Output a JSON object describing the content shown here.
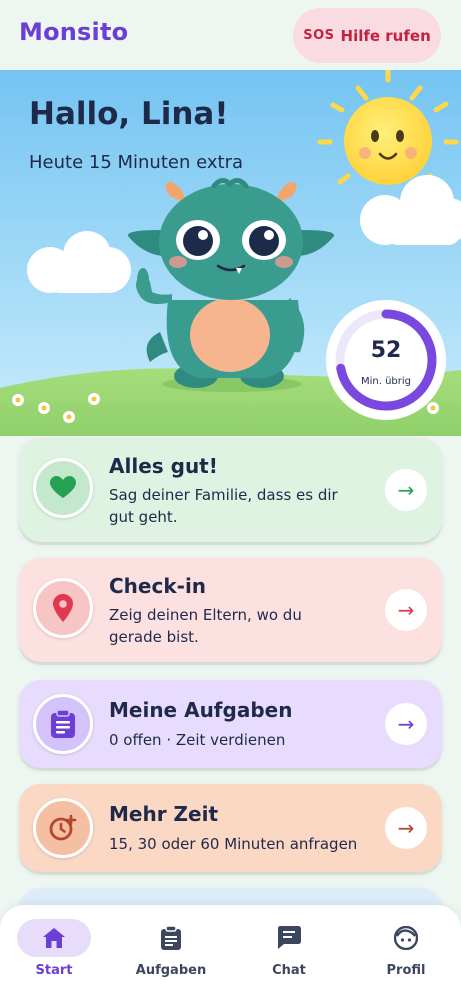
{
  "app": {
    "name": "Monsito",
    "help_button": {
      "icon": "sos-icon",
      "label": "Hilfe rufen"
    }
  },
  "hero": {
    "greeting": "Hallo, Lina!",
    "subtitle": "Heute 15 Minuten extra",
    "timer": {
      "value": "52",
      "unit": "Min. übrig",
      "progress": 0.72
    }
  },
  "cards": [
    {
      "title": "Alles gut!",
      "description": "Sag deiner Familie, dass es dir gut geht.",
      "icon": "heart-icon",
      "color": "#dff3e3"
    },
    {
      "title": "Check-in",
      "description": "Zeig deinen Eltern, wo du gerade bist.",
      "icon": "location-pin-icon",
      "color": "#fde0e0"
    },
    {
      "title": "Meine Aufgaben",
      "description": "0 offen · Zeit verdienen",
      "icon": "clipboard-icon",
      "color": "#e7dcfd"
    },
    {
      "title": "Mehr Zeit",
      "description": "15, 30 oder 60 Minuten anfragen",
      "icon": "clock-plus-icon",
      "color": "#fbd8c4"
    }
  ],
  "nav": {
    "items": [
      {
        "label": "Start",
        "icon": "home-icon",
        "active": true
      },
      {
        "label": "Aufgaben",
        "icon": "clipboard-icon",
        "active": false
      },
      {
        "label": "Chat",
        "icon": "chat-icon",
        "active": false
      },
      {
        "label": "Profil",
        "icon": "profile-icon",
        "active": false
      }
    ]
  },
  "colors": {
    "accent": "#6b3fd6",
    "sos": "#c0233f",
    "background": "#edf6f1"
  }
}
